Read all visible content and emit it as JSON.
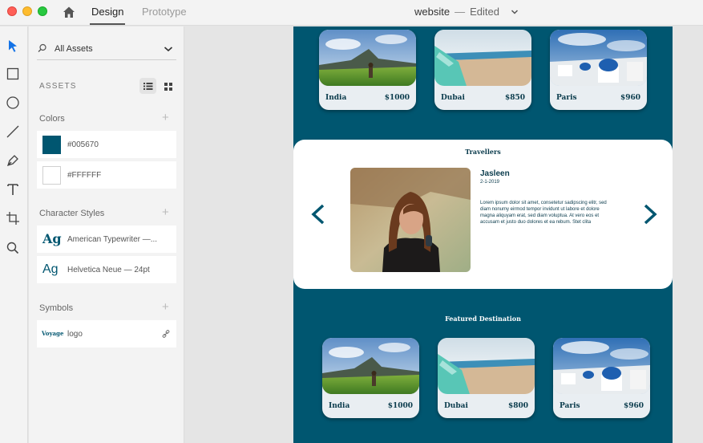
{
  "titlebar": {
    "tab_design": "Design",
    "tab_prototype": "Prototype",
    "document_name": "website",
    "separator": "—",
    "document_status": "Edited"
  },
  "panel": {
    "filter_label": "All Assets",
    "assets_heading": "ASSETS",
    "colors_heading": "Colors",
    "colors": [
      {
        "hex": "#005670",
        "label": "#005670"
      },
      {
        "hex": "#FFFFFF",
        "label": "#FFFFFF"
      }
    ],
    "char_styles_heading": "Character Styles",
    "char_styles": [
      {
        "sample": "Ag",
        "label": "American Typewriter —..."
      },
      {
        "sample": "Ag",
        "label": "Helvetica Neue — 24pt"
      }
    ],
    "symbols_heading": "Symbols",
    "symbols": [
      {
        "thumb": "Voyage",
        "label": "logo"
      }
    ]
  },
  "artboard": {
    "background": "#005670",
    "top_cards": [
      {
        "name": "India",
        "price": "$1000"
      },
      {
        "name": "Dubai",
        "price": "$850"
      },
      {
        "name": "Paris",
        "price": "$960"
      }
    ],
    "travellers": {
      "title": "Travellers",
      "name": "Jasleen",
      "date": "2-1-2019",
      "body": "Lorem ipsum dolor sit amet, consetetur sadipscing elitr, sed diam nonumy eirmod tempor invidunt ut labore et dolore magna aliquyam erat, sed diam voluptua. At vero eos et accusam et justo duo dolores et ea rebum. Stet clita"
    },
    "featured_title": "Featured Destination",
    "featured_cards": [
      {
        "name": "India",
        "price": "$1000"
      },
      {
        "name": "Dubai",
        "price": "$800"
      },
      {
        "name": "Paris",
        "price": "$960"
      }
    ]
  }
}
